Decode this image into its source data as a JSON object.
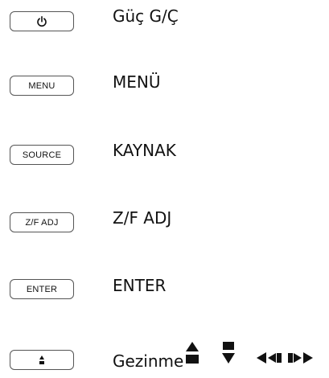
{
  "rows": [
    {
      "key_label": "",
      "key_icon": "power-icon",
      "description": "Güç G/Ç"
    },
    {
      "key_label": "MENU",
      "description": "MENÜ"
    },
    {
      "key_label": "SOURCE",
      "description": "KAYNAK"
    },
    {
      "key_label": "Z/F ADJ",
      "description": "Z/F ADJ"
    },
    {
      "key_label": "ENTER",
      "description": "ENTER"
    },
    {
      "key_label": "",
      "key_icon": "up-down-arrows-icon",
      "description": "Gezinme",
      "nav_icons": [
        "up-down-triangles-icon",
        "left-arrows-icon",
        "right-arrows-icon"
      ]
    }
  ]
}
